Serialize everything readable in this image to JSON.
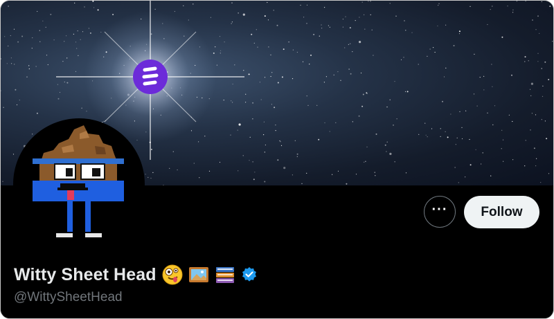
{
  "profile": {
    "display_name": "Witty Sheet Head",
    "handle": "@WittySheetHead",
    "name_emojis": [
      "zany-face-icon",
      "framed-picture-icon",
      "books-icon"
    ],
    "verified": true
  },
  "actions": {
    "more_label": "···",
    "follow_label": "Follow"
  },
  "colors": {
    "verified": "#1d9bf0",
    "brand_logo": "#6c2bd9",
    "follow_bg": "#eff3f4",
    "handle": "#71767b"
  }
}
